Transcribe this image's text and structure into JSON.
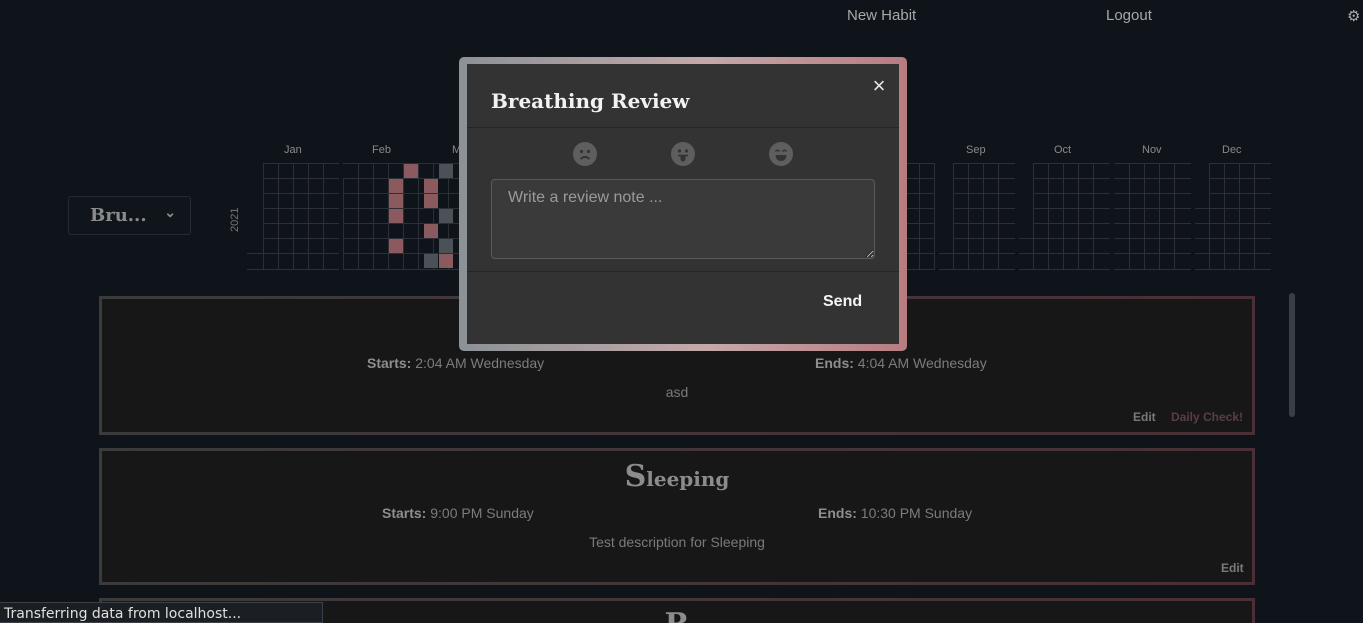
{
  "nav": {
    "new_habit": "New Habit",
    "logout": "Logout"
  },
  "selector": {
    "value": "Bru..."
  },
  "heatmap": {
    "year": "2021",
    "months": [
      "Jan",
      "Feb",
      "M",
      "Sep",
      "Oct",
      "Nov",
      "Dec"
    ]
  },
  "cards": [
    {
      "starts_label": "Starts:",
      "starts": "2:04 AM Wednesday",
      "ends_label": "Ends:",
      "ends": "4:04 AM Wednesday",
      "description": "asd",
      "edit": "Edit",
      "daily": "Daily Check!"
    },
    {
      "title_cap": "S",
      "title_rest": "leeping",
      "starts_label": "Starts:",
      "starts": "9:00 PM Sunday",
      "ends_label": "Ends:",
      "ends": "10:30 PM Sunday",
      "description": "Test description for Sleeping",
      "edit": "Edit"
    },
    {
      "title_cap": "R",
      "title_rest": ""
    }
  ],
  "modal": {
    "title": "Breathing Review",
    "close": "×",
    "emojis": [
      "frown-icon",
      "tongue-icon",
      "smile-icon"
    ],
    "placeholder": "Write a review note ...",
    "send": "Send"
  },
  "status": "Transferring data from localhost..."
}
